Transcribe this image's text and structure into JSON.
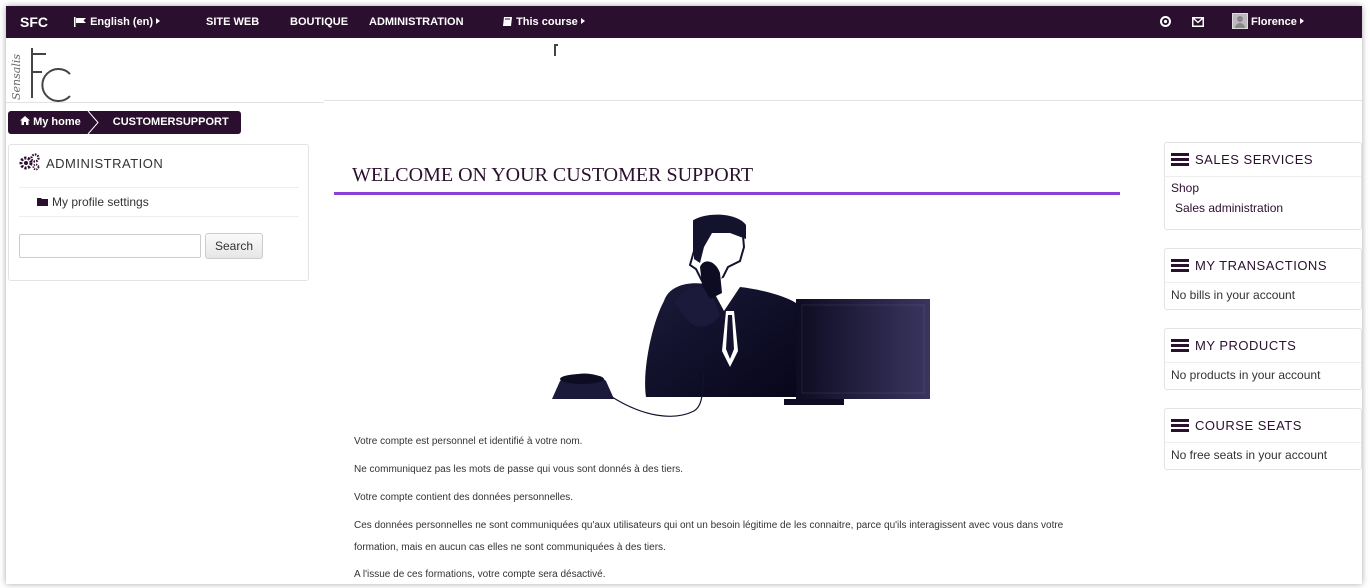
{
  "navbar": {
    "brand": "SFC",
    "language": "English (en)",
    "site_web": "SITE WEB",
    "boutique": "BOUTIQUE",
    "administration": "ADMINISTRATION",
    "this_course": "This course",
    "user": "Florence"
  },
  "breadcrumb": {
    "home": "My home",
    "current": "CUSTOMERSUPPORT"
  },
  "admin_block": {
    "title": "ADMINISTRATION",
    "profile_settings": "My profile settings",
    "search_value": "",
    "search_button": "Search"
  },
  "main": {
    "title": "WELCOME ON YOUR CUSTOMER SUPPORT",
    "paragraphs": [
      "Votre compte est personnel et identifié à votre nom.",
      "Ne communiquez pas les mots de passe qui vous sont donnés à des tiers.",
      "Votre compte contient des données personnelles.",
      "Ces données personnelles ne sont communiquées qu'aux utilisateurs qui ont un besoin légitime de les connaitre, parce qu'ils interagissent avec vous dans votre",
      "formation, mais en aucun cas elles ne sont communiquées à des tiers.",
      "A l'issue de ces formations, votre compte sera désactivé."
    ]
  },
  "sales_services": {
    "title": "SALES SERVICES",
    "shop": "Shop",
    "sales_admin": "Sales administration"
  },
  "my_transactions": {
    "title": "MY TRANSACTIONS",
    "text": "No bills in your account"
  },
  "my_products": {
    "title": "MY PRODUCTS",
    "text": "No products in your account"
  },
  "course_seats": {
    "title": "COURSE SEATS",
    "text": "No free seats in your account"
  },
  "colors": {
    "navbar": "#2b0f2e",
    "accent_rule": "#8d40d8"
  }
}
